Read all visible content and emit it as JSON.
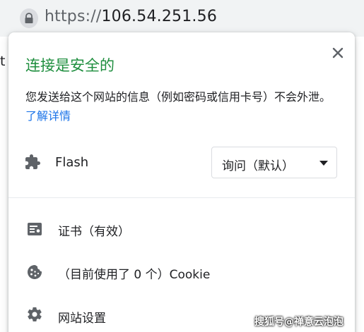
{
  "urlbar": {
    "scheme": "https://",
    "host": "106.54.251.56"
  },
  "page": {
    "edge_text": "t"
  },
  "popup": {
    "title": "连接是安全的",
    "description": "您发送给这个网站的信息（例如密码或信用卡号）不会外泄。",
    "learn_more": "了解详情",
    "flash": {
      "label": "Flash",
      "selected": "询问（默认）"
    },
    "items": [
      {
        "label": "证书（有效）",
        "icon": "certificate-icon"
      },
      {
        "label": "（目前使用了 0 个）Cookie",
        "icon": "cookie-icon"
      },
      {
        "label": "网站设置",
        "icon": "gear-icon"
      }
    ]
  },
  "watermark": "搜狐号@禅意云泡泡",
  "colors": {
    "secure_green": "#1e8e3e",
    "link_blue": "#1a73e8",
    "urlbar_bg": "#f1f3f4"
  }
}
